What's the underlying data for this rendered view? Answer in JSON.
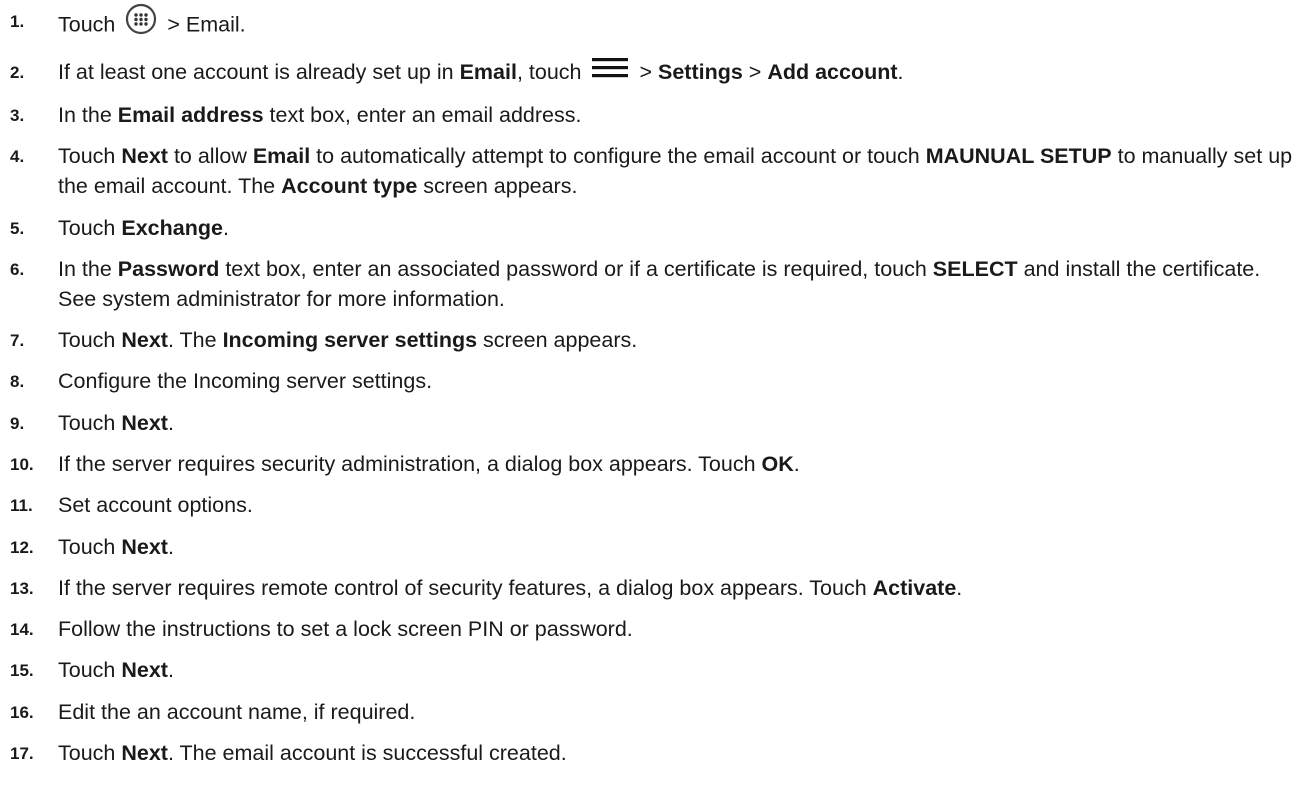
{
  "steps": [
    {
      "num": "1.",
      "parts": [
        {
          "t": "Touch "
        },
        {
          "icon": "apps-icon"
        },
        {
          "t": " > Email."
        }
      ]
    },
    {
      "num": "2.",
      "parts": [
        {
          "t": "If at least one account is already set up in "
        },
        {
          "b": "Email"
        },
        {
          "t": ", touch "
        },
        {
          "icon": "menu-icon"
        },
        {
          "t": " > "
        },
        {
          "b": "Settings"
        },
        {
          "t": " > "
        },
        {
          "b": "Add account"
        },
        {
          "t": "."
        }
      ]
    },
    {
      "num": "3.",
      "parts": [
        {
          "t": "In the "
        },
        {
          "b": "Email address"
        },
        {
          "t": " text box, enter an email address."
        }
      ]
    },
    {
      "num": "4.",
      "parts": [
        {
          "t": "Touch "
        },
        {
          "b": "Next"
        },
        {
          "t": " to allow "
        },
        {
          "b": "Email"
        },
        {
          "t": " to automatically attempt to configure the email account or touch "
        },
        {
          "b": "MAUNUAL SETUP"
        },
        {
          "t": " to manually set up the email account. The "
        },
        {
          "b": "Account type"
        },
        {
          "t": " screen appears."
        }
      ]
    },
    {
      "num": "5.",
      "parts": [
        {
          "t": "Touch "
        },
        {
          "b": "Exchange"
        },
        {
          "t": "."
        }
      ]
    },
    {
      "num": "6.",
      "parts": [
        {
          "t": "In the "
        },
        {
          "b": "Password"
        },
        {
          "t": " text box, enter an associated password or if a certificate is required, touch "
        },
        {
          "b": "SELECT"
        },
        {
          "t": " and install the certificate. See system administrator for more information."
        }
      ]
    },
    {
      "num": "7.",
      "parts": [
        {
          "t": "Touch "
        },
        {
          "b": "Next"
        },
        {
          "t": ". The "
        },
        {
          "b": "Incoming server settings"
        },
        {
          "t": " screen appears."
        }
      ]
    },
    {
      "num": "8.",
      "parts": [
        {
          "t": "Configure the Incoming server settings."
        }
      ]
    },
    {
      "num": "9.",
      "parts": [
        {
          "t": "Touch "
        },
        {
          "b": "Next"
        },
        {
          "t": "."
        }
      ]
    },
    {
      "num": "10.",
      "parts": [
        {
          "t": "If the server requires security administration, a dialog box appears. Touch "
        },
        {
          "b": "OK"
        },
        {
          "t": "."
        }
      ]
    },
    {
      "num": "11.",
      "parts": [
        {
          "t": "Set account options."
        }
      ]
    },
    {
      "num": "12.",
      "parts": [
        {
          "t": "Touch "
        },
        {
          "b": "Next"
        },
        {
          "t": "."
        }
      ]
    },
    {
      "num": "13.",
      "parts": [
        {
          "t": "If the server requires remote control of security features, a dialog box appears. Touch "
        },
        {
          "b": "Activate"
        },
        {
          "t": "."
        }
      ]
    },
    {
      "num": "14.",
      "parts": [
        {
          "t": "Follow the instructions to set a lock screen PIN or password."
        }
      ]
    },
    {
      "num": "15.",
      "parts": [
        {
          "t": "Touch "
        },
        {
          "b": "Next"
        },
        {
          "t": "."
        }
      ]
    },
    {
      "num": "16.",
      "parts": [
        {
          "t": "Edit the an account name, if required."
        }
      ]
    },
    {
      "num": "17.",
      "parts": [
        {
          "t": "Touch "
        },
        {
          "b": "Next"
        },
        {
          "t": ". The email account is successful created."
        }
      ]
    }
  ]
}
